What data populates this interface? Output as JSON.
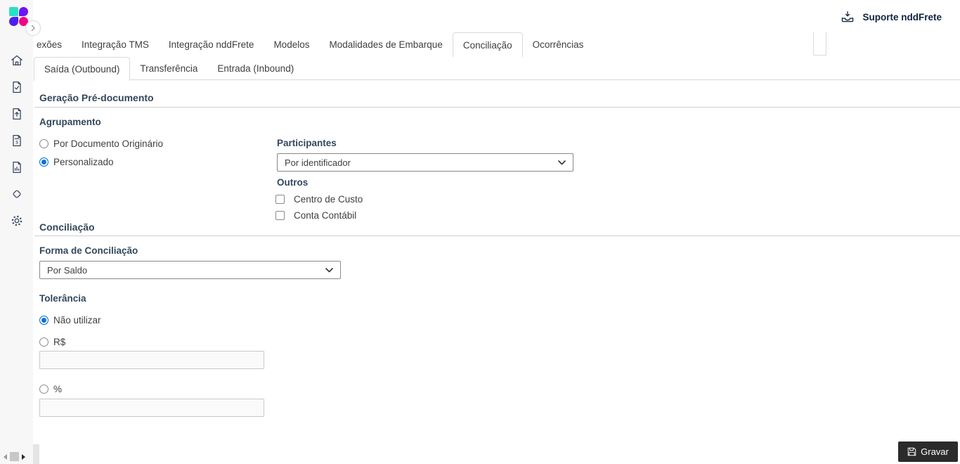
{
  "header": {
    "support_label": "Suporte nddFrete",
    "support_icon": "inbox-download-icon"
  },
  "logo": {
    "colors": {
      "teal": "#29e0c4",
      "purple": "#6c16f6",
      "indigo": "#4a20f2",
      "pink": "#f20387"
    }
  },
  "sidebar": {
    "items": [
      {
        "icon": "home-icon"
      },
      {
        "icon": "document-check-icon"
      },
      {
        "icon": "document-upload-icon"
      },
      {
        "icon": "document-invoice-icon"
      },
      {
        "icon": "document-report-icon"
      },
      {
        "icon": "diamond-sync-icon"
      },
      {
        "icon": "settings-gear-icon"
      }
    ]
  },
  "tabs_primary": {
    "items": [
      {
        "label": "exões",
        "active": false,
        "clipped": true
      },
      {
        "label": "Integração TMS",
        "active": false
      },
      {
        "label": "Integração nddFrete",
        "active": false
      },
      {
        "label": "Modelos",
        "active": false
      },
      {
        "label": "Modalidades de Embarque",
        "active": false
      },
      {
        "label": "Conciliação",
        "active": true
      },
      {
        "label": "Ocorrências",
        "active": false
      }
    ]
  },
  "tabs_secondary": {
    "items": [
      {
        "label": "Saída (Outbound)",
        "active": true
      },
      {
        "label": "Transferência",
        "active": false
      },
      {
        "label": "Entrada (Inbound)",
        "active": false
      }
    ]
  },
  "form": {
    "pre_documento": {
      "title": "Geração Pré-documento",
      "agrupamento_label": "Agrupamento",
      "agrupamento_options": [
        {
          "label": "Por Documento Originário",
          "selected": false
        },
        {
          "label": "Personalizado",
          "selected": true
        }
      ],
      "participantes_label": "Participantes",
      "participantes_value": "Por identificador",
      "outros_label": "Outros",
      "outros_checkboxes": [
        {
          "label": "Centro de Custo",
          "checked": false
        },
        {
          "label": "Conta Contábil",
          "checked": false
        }
      ]
    },
    "conciliacao": {
      "title": "Conciliação",
      "forma_label": "Forma de Conciliação",
      "forma_value": "Por Saldo",
      "tolerancia_label": "Tolerância",
      "tolerancia_options": [
        {
          "label": "Não utilizar",
          "selected": true
        },
        {
          "label": "R$",
          "selected": false,
          "input_value": ""
        },
        {
          "label": "%",
          "selected": false,
          "input_value": ""
        }
      ]
    }
  },
  "footer": {
    "save_label": "Gravar",
    "save_icon": "floppy-disk-icon"
  },
  "colors": {
    "accent_radio": "#0070e0",
    "save_button_bg": "#2b2b2b",
    "heading_text": "#33475b",
    "tab_border": "#d9d9d9",
    "sidebar_bg": "#f7f7f7"
  }
}
